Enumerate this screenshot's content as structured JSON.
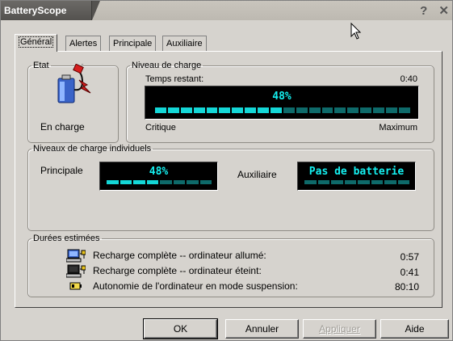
{
  "window": {
    "title": "BatteryScope",
    "help_glyph": "?",
    "close_glyph": "✕"
  },
  "tabs": [
    {
      "label": "Général",
      "active": true
    },
    {
      "label": "Alertes"
    },
    {
      "label": "Principale"
    },
    {
      "label": "Auxiliaire"
    }
  ],
  "etat": {
    "legend": "Etat",
    "status": "En charge",
    "icon": "battery-plug-icon"
  },
  "charge": {
    "legend": "Niveau de charge",
    "time_label": "Temps restant:",
    "time_value": "0:40",
    "percent": "48%",
    "level_fraction": 0.48,
    "min_label": "Critique",
    "max_label": "Maximum"
  },
  "individual": {
    "legend": "Niveaux de charge individuels",
    "principale_label": "Principale",
    "principale_value": "48%",
    "principale_fraction": 0.48,
    "auxiliaire_label": "Auxiliaire",
    "auxiliaire_value": "Pas de batterie",
    "auxiliaire_fraction": 0
  },
  "durees": {
    "legend": "Durées estimées",
    "rows": [
      {
        "label": "Recharge complète -- ordinateur allumé:",
        "value": "0:57",
        "icon": "computer-on-icon"
      },
      {
        "label": "Recharge complète -- ordinateur éteint:",
        "value": "0:41",
        "icon": "computer-off-icon"
      },
      {
        "label": "Autonomie de l'ordinateur en mode suspension:",
        "value": "80:10",
        "icon": "battery-icon"
      }
    ]
  },
  "buttons": {
    "ok": "OK",
    "cancel": "Annuler",
    "apply": "Appliquer",
    "help": "Aide"
  },
  "colors": {
    "lcd_on": "#14d7d7",
    "lcd_off": "#0e6a6a",
    "lcd_bg": "#000000"
  }
}
